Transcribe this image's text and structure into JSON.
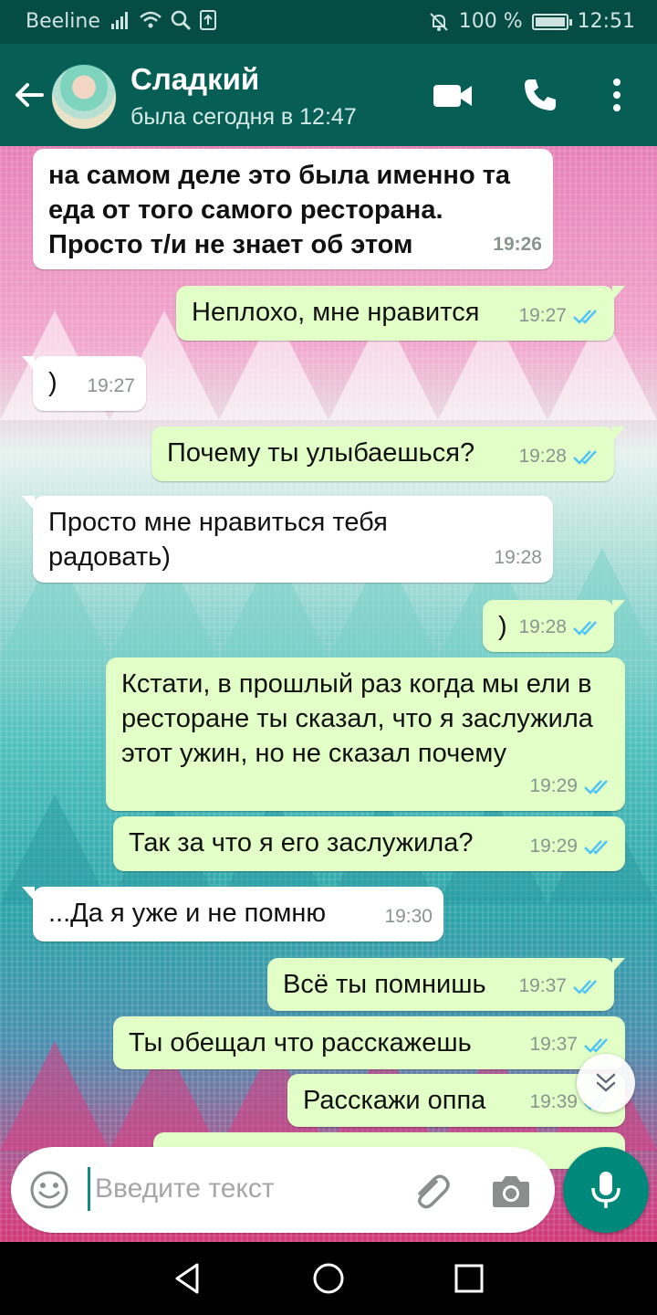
{
  "status_bar": {
    "carrier": "Beeline",
    "battery": "100 %",
    "time": "12:51"
  },
  "header": {
    "contact_name": "Сладкий",
    "last_seen": "была сегодня в 12:47",
    "icons": [
      "back-arrow-icon",
      "avatar",
      "video-call-icon",
      "phone-call-icon",
      "more-vert-icon"
    ]
  },
  "messages": [
    {
      "dir": "in",
      "text": "на самом деле это была именно та еда от того самого ресторана. Просто т/и не знает об этом",
      "time": "19:26"
    },
    {
      "dir": "out",
      "text": "Неплохо, мне нравится",
      "time": "19:27"
    },
    {
      "dir": "in",
      "text": ")",
      "time": "19:27"
    },
    {
      "dir": "out",
      "text": "Почему ты улыбаешься?",
      "time": "19:28"
    },
    {
      "dir": "in",
      "text": "Просто мне нравиться тебя радовать)",
      "time": "19:28"
    },
    {
      "dir": "out",
      "text": ")",
      "time": "19:28"
    },
    {
      "dir": "out",
      "text": "Кстати, в прошлый раз когда мы ели в ресторане ты сказал, что я заслужила этот ужин, но не сказал почему",
      "time": "19:29"
    },
    {
      "dir": "out",
      "text": "Так за что я его заслужила?",
      "time": "19:29"
    },
    {
      "dir": "in",
      "text": "...Да я уже и не помню",
      "time": "19:30"
    },
    {
      "dir": "out",
      "text": "Всё ты помнишь",
      "time": "19:37"
    },
    {
      "dir": "out",
      "text": "Ты обещал что расскажешь",
      "time": "19:37"
    },
    {
      "dir": "out",
      "text": "Расскажи оппа",
      "time": "19:39"
    }
  ],
  "composer": {
    "placeholder": "Введите текст",
    "value": ""
  },
  "colors": {
    "header": "#075e54",
    "status_bar": "#054d44",
    "outgoing_bubble": "#e1ffc7",
    "incoming_bubble": "#ffffff",
    "read_ticks": "#4fc3f7",
    "mic_button": "#00897b"
  }
}
